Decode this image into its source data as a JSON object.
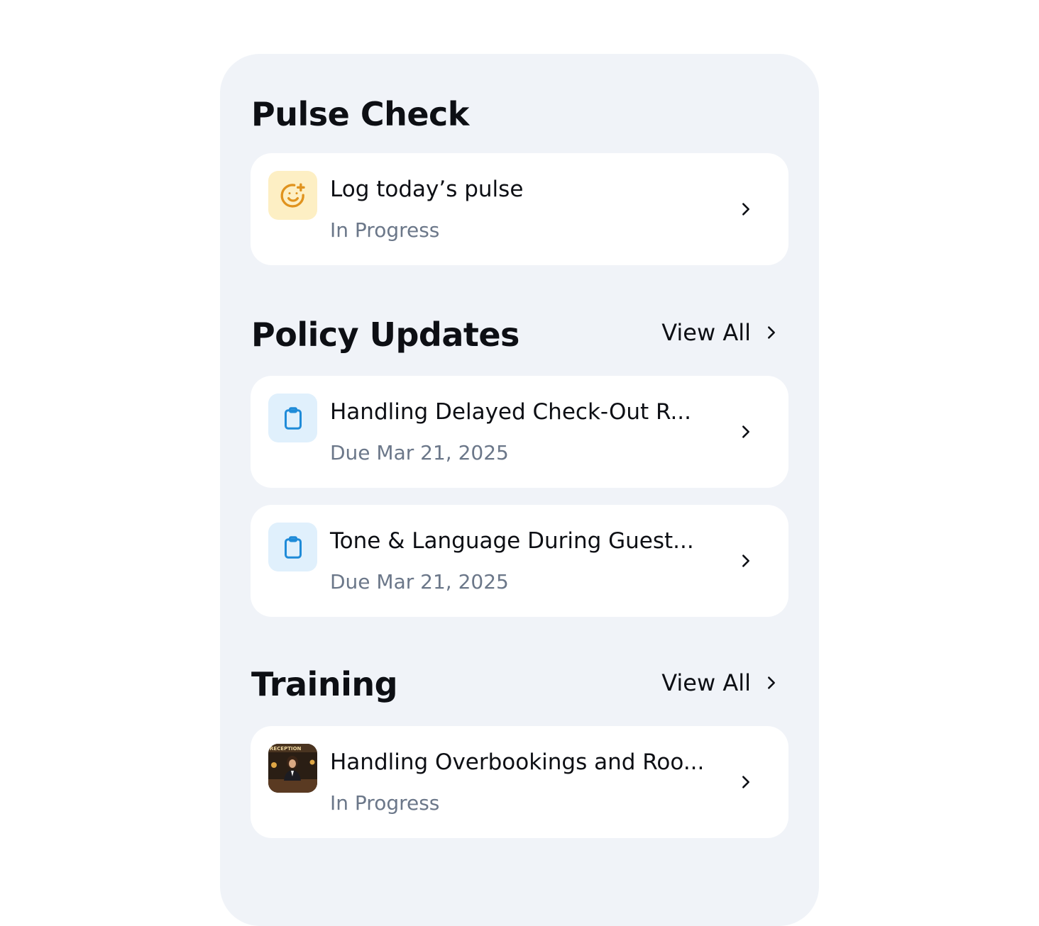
{
  "pulse_check": {
    "title": "Pulse Check",
    "card": {
      "title": "Log today’s pulse",
      "status": "In Progress",
      "icon": "smile-plus-icon"
    }
  },
  "policy_updates": {
    "title": "Policy Updates",
    "view_all": "View All",
    "items": [
      {
        "title": "Handling Delayed Check-Out R...",
        "due": "Due Mar 21, 2025",
        "icon": "clipboard-icon"
      },
      {
        "title": "Tone & Language During Guest...",
        "due": "Due Mar 21, 2025",
        "icon": "clipboard-icon"
      }
    ]
  },
  "training": {
    "title": "Training",
    "view_all": "View All",
    "items": [
      {
        "title": "Handling Overbookings and Roo...",
        "status": "In Progress",
        "thumbnail_sign": "RECEPTION"
      }
    ]
  },
  "colors": {
    "panel_bg": "#f0f3f8",
    "pulse_icon_bg": "#fdefc4",
    "pulse_icon": "#e0931e",
    "policy_icon_bg": "#e0f0fc",
    "policy_icon": "#1f8bd8",
    "subtitle": "#6b7789"
  }
}
